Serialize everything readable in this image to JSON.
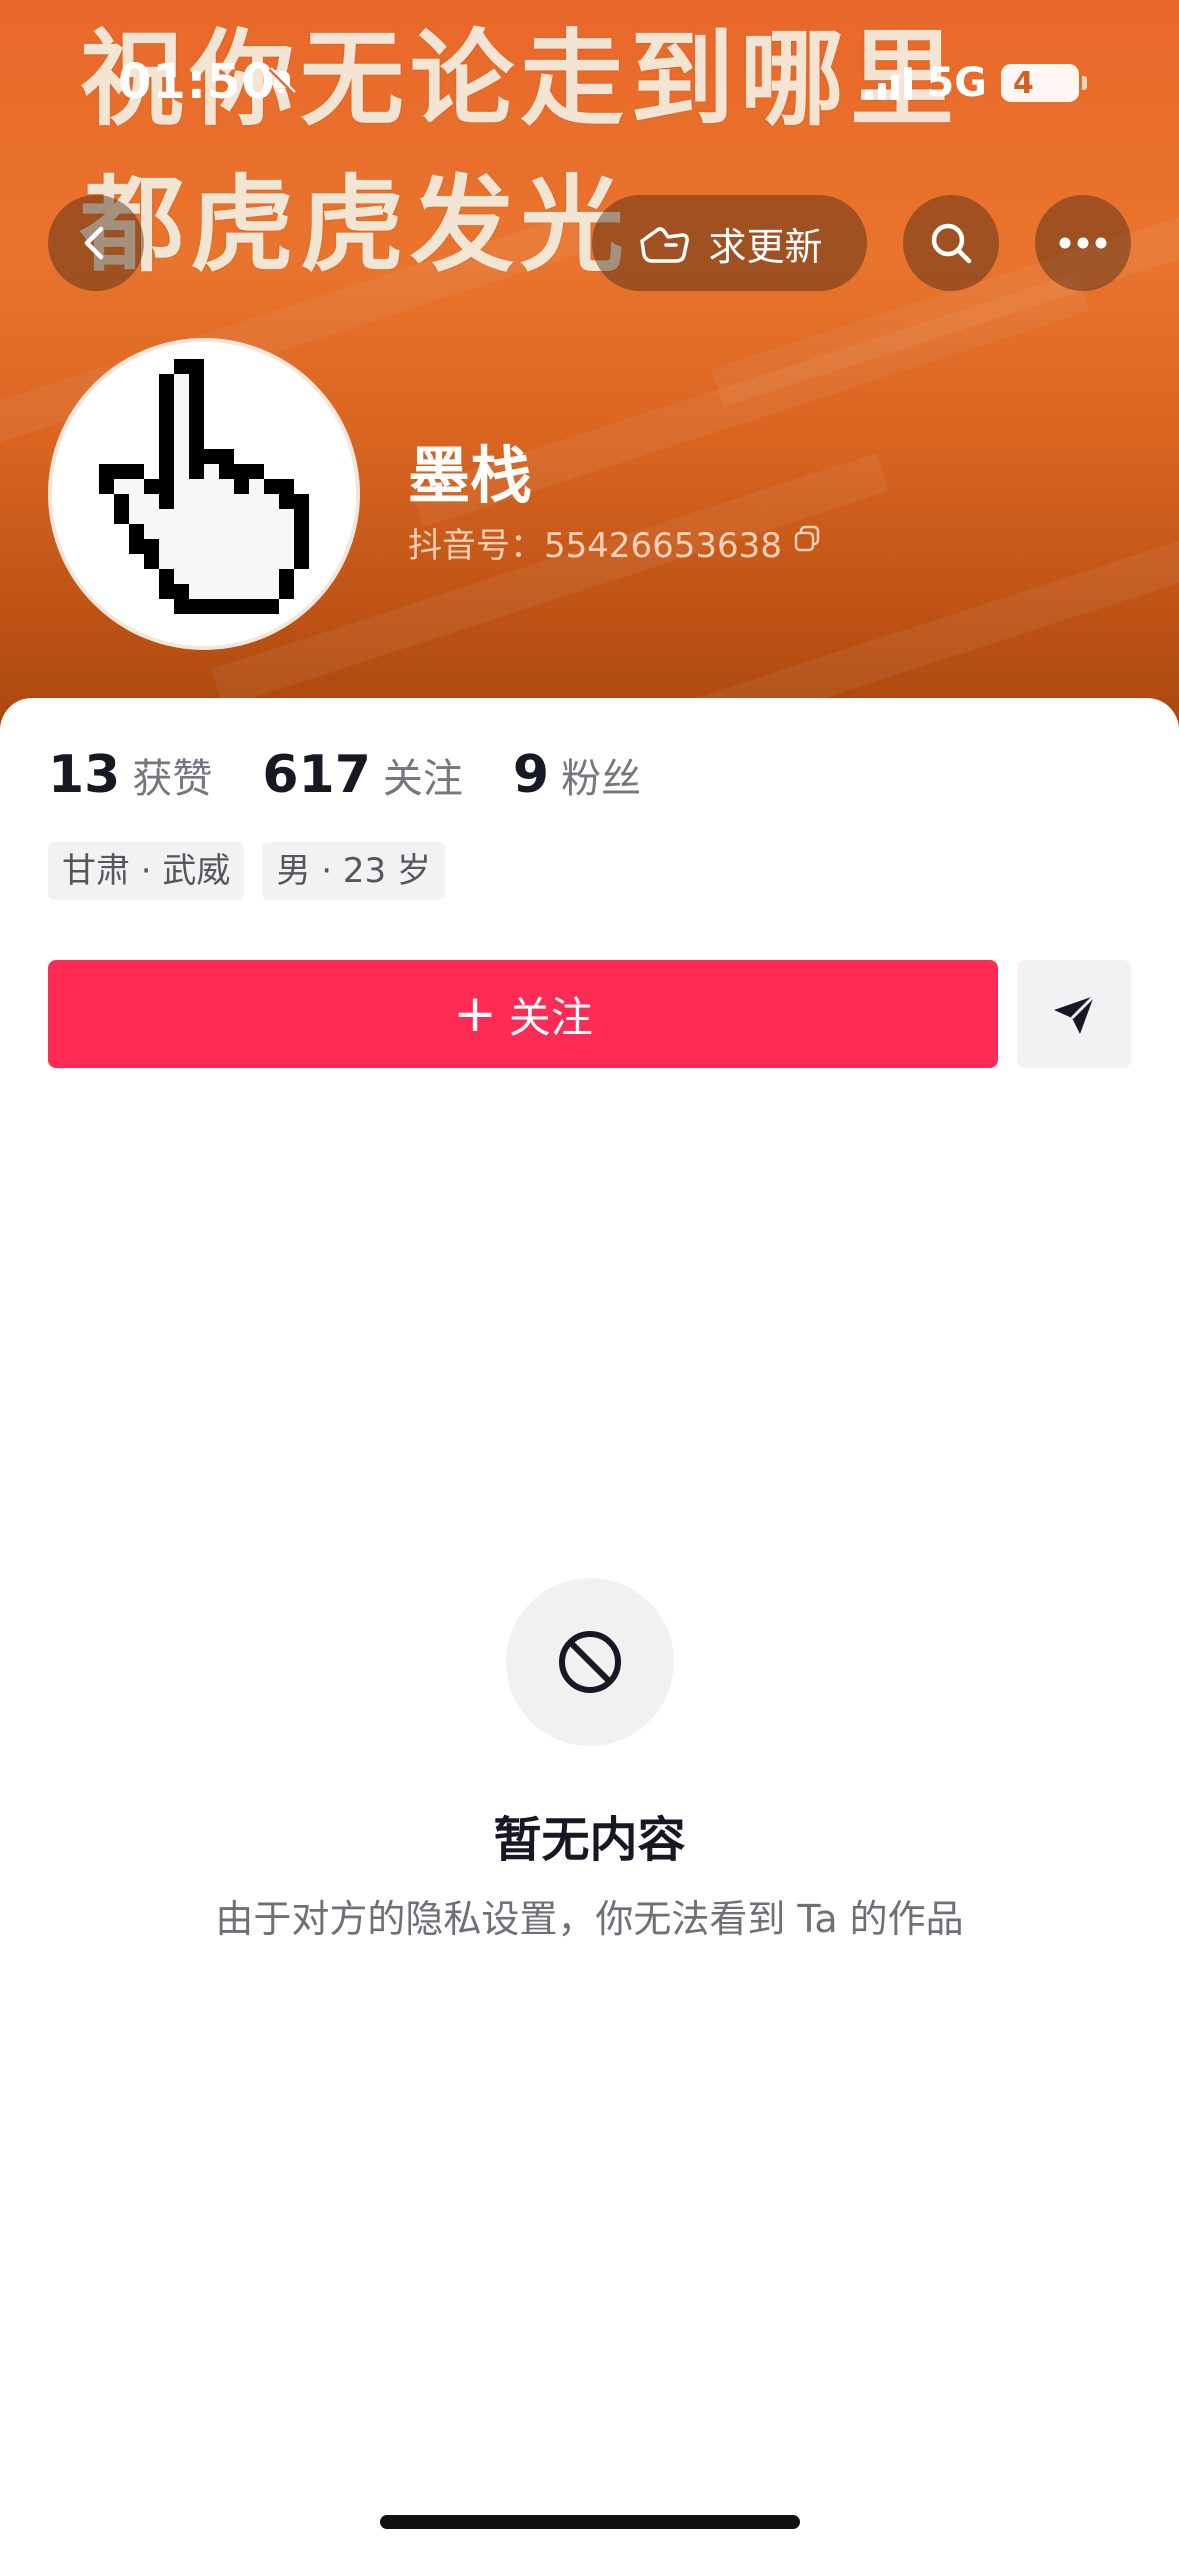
{
  "status_bar": {
    "time": "01:50",
    "network": "5G",
    "battery": "4"
  },
  "banner": {
    "calligraphy_line1": "祝你无论走到哪里",
    "calligraphy_line2": "都虎虎发光"
  },
  "nav": {
    "back_icon": "chevron-left-icon",
    "request_update_label": "求更新",
    "search_icon": "search-icon",
    "more_icon": "more-icon"
  },
  "profile": {
    "name": "墨栈",
    "douyin_id": "抖音号：55426653638",
    "avatar_icon": "hand-cursor-icon"
  },
  "stats": {
    "likes_count": "13",
    "likes_label": "获赞",
    "following_count": "617",
    "following_label": "关注",
    "followers_count": "9",
    "followers_label": "粉丝"
  },
  "tags": {
    "location": "甘肃 · 武威",
    "gender_age": "男 · 23 岁"
  },
  "actions": {
    "follow_label": "关注",
    "share_icon": "send-icon"
  },
  "empty_state": {
    "title": "暂无内容",
    "description": "由于对方的隐私设置，你无法看到 Ta 的作品"
  },
  "colors": {
    "banner": "#e9682a",
    "follow_button": "#fe2c55",
    "text_primary": "#161823",
    "text_secondary": "#75767e"
  }
}
